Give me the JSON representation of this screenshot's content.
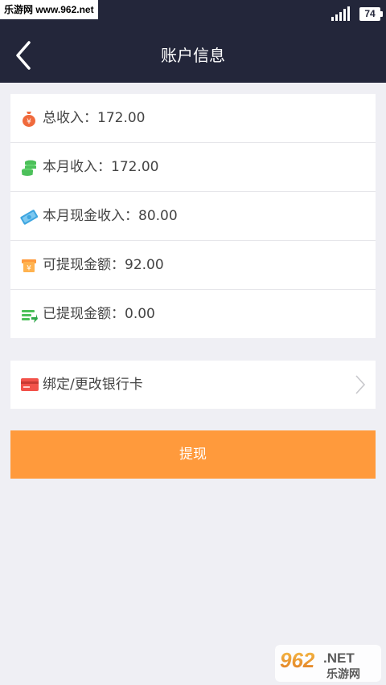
{
  "status_bar": {
    "watermark": "乐游网 www.962.net",
    "battery": "74"
  },
  "nav": {
    "title": "账户信息",
    "back_icon": "chevron-left-icon"
  },
  "stats": [
    {
      "icon": "money-bag-icon",
      "label": "总收入：172.00"
    },
    {
      "icon": "coin-stack-icon",
      "label": "本月收入：172.00"
    },
    {
      "icon": "cash-note-icon",
      "label": "本月现金收入：80.00"
    },
    {
      "icon": "withdrawable-card-icon",
      "label": "可提现金额：92.00"
    },
    {
      "icon": "transfer-icon",
      "label": "已提现金额：0.00"
    }
  ],
  "bank_card": {
    "icon": "bank-card-icon",
    "label": "绑定/更改银行卡",
    "chevron": "chevron-right-icon"
  },
  "withdraw_button": {
    "label": "提现"
  },
  "watermark_logo": {
    "top": "962.NET",
    "bottom": "乐游网"
  },
  "colors": {
    "header_bg": "#23263a",
    "page_bg": "#efeff4",
    "accent_orange": "#ff9a3c",
    "coin_green": "#4cc05a",
    "cash_blue": "#3fa6e0"
  }
}
